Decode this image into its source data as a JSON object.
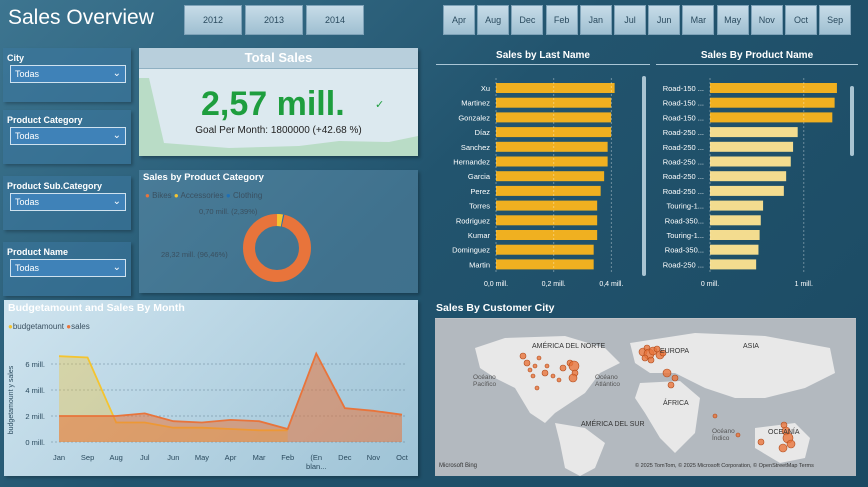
{
  "header": {
    "title": "Sales Overview"
  },
  "years": [
    "2012",
    "2013",
    "2014"
  ],
  "months": [
    "Apr",
    "Aug",
    "Dec",
    "Feb",
    "Jan",
    "Jul",
    "Jun",
    "Mar",
    "May",
    "Nov",
    "Oct",
    "Sep"
  ],
  "slicers": [
    {
      "label": "City",
      "value": "Todas"
    },
    {
      "label": "Product Category",
      "value": "Todas"
    },
    {
      "label": "Product Sub.Category",
      "value": "Todas"
    },
    {
      "label": "Product Name",
      "value": "Todas"
    }
  ],
  "kpi": {
    "title": "Total Sales",
    "value": "2,57 mill.",
    "goal": "Goal Per Month: 1800000 (+42.68 %)",
    "check": "✓"
  },
  "donut": {
    "title": "Sales by Product Category",
    "legend": [
      "Bikes",
      "Accessories",
      "Clothing"
    ],
    "label_small": "0,70 mill. (2,39%)",
    "label_big": "28,32 mill. (96,46%)"
  },
  "colors": {
    "bikes": "#e8743b",
    "accessories": "#f4c430",
    "clothing": "#1f6fb5",
    "bar": "#f0b020",
    "bar_light": "#f3dc8f",
    "budget": "#f4c430",
    "sales": "#e8743b"
  },
  "chart_data": [
    {
      "type": "bar",
      "title": "Sales by Last Name",
      "orientation": "horizontal",
      "categories": [
        "Xu",
        "Martinez",
        "Gonzalez",
        "Díaz",
        "Sanchez",
        "Hernandez",
        "Garcia",
        "Perez",
        "Torres",
        "Rodriguez",
        "Kumar",
        "Dominguez",
        "Martin"
      ],
      "values": [
        0.34,
        0.33,
        0.33,
        0.33,
        0.32,
        0.32,
        0.31,
        0.3,
        0.29,
        0.29,
        0.29,
        0.28,
        0.28
      ],
      "xticks": [
        "0,0 mill.",
        "0,2 mill.",
        "0,4 mill."
      ],
      "xlim": [
        0,
        0.43
      ]
    },
    {
      "type": "bar",
      "title": "Sales By Product Name",
      "orientation": "horizontal",
      "categories": [
        "Road-150 ...",
        "Road-150 ...",
        "Road-150 ...",
        "Road-250 ...",
        "Road-250 ...",
        "Road-250 ...",
        "Road-250 ...",
        "Road-250 ...",
        "Touring-1...",
        "Road-350...",
        "Touring-1...",
        "Road-350...",
        "Road-250 ..."
      ],
      "values": [
        1.1,
        1.08,
        1.06,
        0.76,
        0.72,
        0.7,
        0.66,
        0.64,
        0.46,
        0.44,
        0.43,
        0.42,
        0.4
      ],
      "xticks": [
        "0 mill.",
        "1 mill."
      ],
      "xlim": [
        0,
        1.3
      ]
    },
    {
      "type": "area",
      "title": "Budgetamount and Sales By Month",
      "categories": [
        "Jan",
        "Sep",
        "Aug",
        "Jul",
        "Jun",
        "May",
        "Apr",
        "Mar",
        "Feb",
        "(En blan...",
        "Dec",
        "Nov",
        "Oct"
      ],
      "series": [
        {
          "name": "budgetamount",
          "values": [
            6.6,
            6.5,
            1.5,
            1.5,
            1.1,
            1.1,
            1.0,
            0.9,
            0.9,
            null,
            null,
            null,
            null
          ]
        },
        {
          "name": "sales",
          "values": [
            2.0,
            2.0,
            2.0,
            2.2,
            1.6,
            1.5,
            1.7,
            1.6,
            1.0,
            6.8,
            2.6,
            2.4,
            2.1
          ]
        }
      ],
      "yticks": [
        "0 mill.",
        "2 mill.",
        "4 mill.",
        "6 mill."
      ],
      "ylabel": "budgetamount y sales",
      "ylim": [
        0,
        8
      ]
    }
  ],
  "map": {
    "title": "Sales By Customer City",
    "labels": [
      "AMÉRICA DEL NORTE",
      "EUROPA",
      "ASIA",
      "ÁFRICA",
      "AMÉRICA DEL SUR",
      "OCEANÍA",
      "Océano Pacífico",
      "Océano Atlántico",
      "Océano Índico"
    ],
    "footer": "© 2025 TomTom, © 2025 Microsoft Corporation, © OpenStreetMap  Terms",
    "brand": "Microsoft Bing"
  }
}
